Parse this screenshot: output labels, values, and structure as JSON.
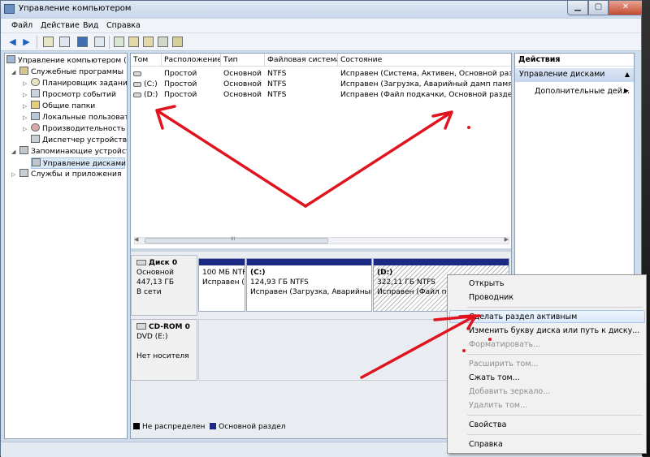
{
  "window": {
    "title": "Управление компьютером"
  },
  "menu": [
    "Файл",
    "Действие",
    "Вид",
    "Справка"
  ],
  "tree": {
    "root": "Управление компьютером (л",
    "items": [
      "Служебные программы",
      "Планировщик заданий",
      "Просмотр событий",
      "Общие папки",
      "Локальные пользовато",
      "Производительность",
      "Диспетчер устройств",
      "Запоминающие устройст",
      "Управление дисками",
      "Службы и приложения"
    ]
  },
  "volumes": {
    "columns": [
      "Том",
      "Расположение",
      "Тип",
      "Файловая система",
      "Состояние"
    ],
    "rows": [
      [
        "",
        "Простой",
        "Основной",
        "NTFS",
        "Исправен (Система, Активен, Основной раздел)"
      ],
      [
        "(C:)",
        "Простой",
        "Основной",
        "NTFS",
        "Исправен (Загрузка, Аварийный дамп памяти, С"
      ],
      [
        "(D:)",
        "Простой",
        "Основной",
        "NTFS",
        "Исправен (Файл подкачки, Основной раздел)"
      ]
    ]
  },
  "scroll_grip": "III",
  "disks": {
    "disk0": {
      "name": "Диск 0",
      "type": "Основной",
      "size": "447,13 ГБ",
      "status": "В сети",
      "partitions": [
        {
          "label": "",
          "size": "100 МБ NTFS",
          "status": "Исправен ("
        },
        {
          "label": "(C:)",
          "size": "124,93 ГБ NTFS",
          "status": "Исправен (Загрузка, Аварийный"
        },
        {
          "label": "(D:)",
          "size": "322,11 ГБ NTFS",
          "status": "Исправен (Файл по"
        }
      ]
    },
    "cdrom": {
      "name": "CD-ROM 0",
      "type": "DVD (E:)",
      "status": "Нет носителя"
    }
  },
  "legend": {
    "unallocated": "Не распределен",
    "primary": "Основной раздел",
    "unallocated_color": "#000000",
    "primary_color": "#1c2a85"
  },
  "actions": {
    "header": "Действия",
    "section": "Управление дисками",
    "more": "Дополнительные дей..."
  },
  "context_menu": {
    "open": "Открыть",
    "explorer": "Проводник",
    "make_active": "Сделать раздел активным",
    "change_letter": "Изменить букву диска или путь к диску...",
    "format": "Форматировать...",
    "extend": "Расширить том...",
    "shrink": "Сжать том...",
    "add_mirror": "Добавить зеркало...",
    "delete": "Удалить том...",
    "properties": "Свойства",
    "help": "Справка"
  },
  "colors": {
    "accent": "#1c2a85",
    "annotation": "#e0141e",
    "menu_highlight": "#dbe9fa"
  }
}
